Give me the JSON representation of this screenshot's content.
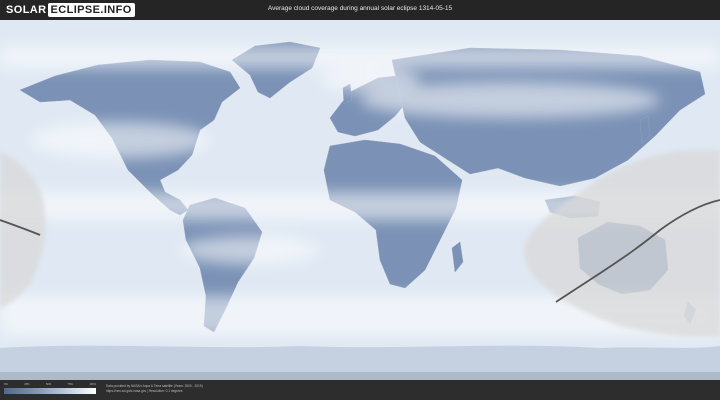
{
  "header": {
    "logo_solar": "SOLAR",
    "logo_eclipse": "ECLIPSE.INFO",
    "title": "Average cloud coverage during annual solar eclipse 1314-05-15"
  },
  "map": {
    "ocean_color": "#dfe8f3",
    "land_color": "#6f87ad",
    "cloud_color": "#ffffff",
    "eclipse_zone_color": "#d8d8d8",
    "eclipse_path_color": "#555555",
    "antarctic_color": "#c5d1e1"
  },
  "legend": {
    "ticks": [
      "0%",
      "25%",
      "50%",
      "75%",
      "100%"
    ]
  },
  "credits": {
    "line1": "Data provided by NASA's Aqua & Terra satellite (Years: 2000 - 2019)",
    "line2": "https://neo.sci.gsfc.nasa.gov | Resolution: 0.1 degrees"
  }
}
